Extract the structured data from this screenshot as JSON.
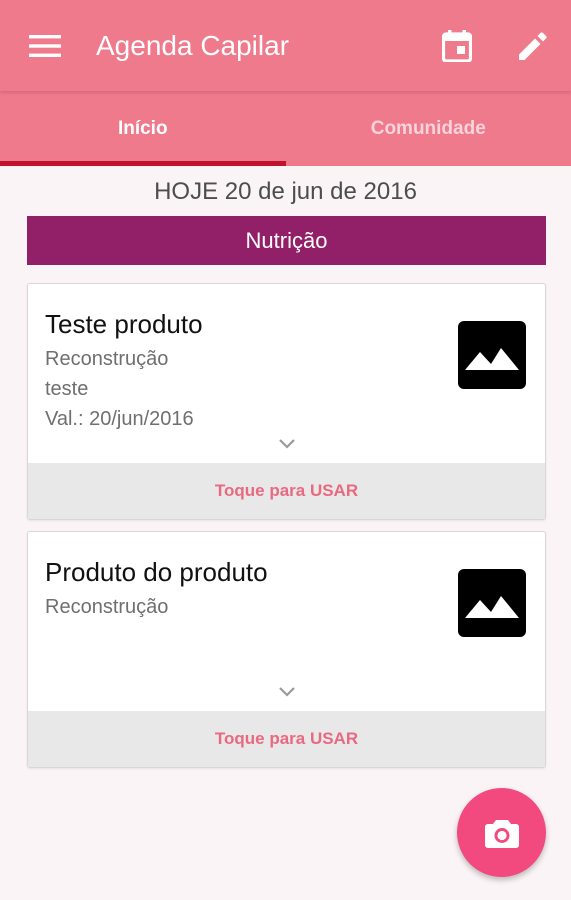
{
  "app": {
    "title": "Agenda Capilar",
    "accent_color": "#ef7a8c",
    "fab_color": "#f2497e",
    "section_color": "#922069"
  },
  "toolbar": {
    "menu_icon": "menu-icon",
    "calendar_icon": "calendar-icon",
    "edit_icon": "edit-icon"
  },
  "tabs": [
    {
      "label": "Início",
      "active": true
    },
    {
      "label": "Comunidade",
      "active": false
    }
  ],
  "date_header": "HOJE 20 de jun de 2016",
  "section": {
    "label": "Nutrição"
  },
  "products": [
    {
      "name": "Teste produto",
      "category": "Reconstrução",
      "note": "teste",
      "validity": "Val.: 20/jun/2016",
      "image_icon": "image-placeholder-icon",
      "action_label": "Toque para USAR"
    },
    {
      "name": "Produto do produto",
      "category": "Reconstrução",
      "note": "",
      "validity": "",
      "image_icon": "image-placeholder-icon",
      "action_label": "Toque para USAR"
    }
  ],
  "fab": {
    "icon": "camera-icon"
  }
}
